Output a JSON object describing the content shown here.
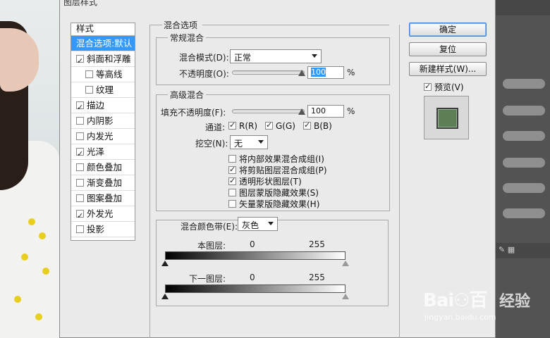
{
  "dialog": {
    "title": "图层样式"
  },
  "styles_list": {
    "header": "样式",
    "items": [
      {
        "label": "混合选项:默认",
        "checkbox": false,
        "selected": true,
        "indent": false
      },
      {
        "label": "斜面和浮雕",
        "checkbox": true,
        "checked": true,
        "indent": false
      },
      {
        "label": "等高线",
        "checkbox": true,
        "checked": false,
        "indent": true
      },
      {
        "label": "纹理",
        "checkbox": true,
        "checked": false,
        "indent": true
      },
      {
        "label": "描边",
        "checkbox": true,
        "checked": true,
        "indent": false
      },
      {
        "label": "内阴影",
        "checkbox": true,
        "checked": false,
        "indent": false
      },
      {
        "label": "内发光",
        "checkbox": true,
        "checked": false,
        "indent": false
      },
      {
        "label": "光泽",
        "checkbox": true,
        "checked": true,
        "indent": false
      },
      {
        "label": "颜色叠加",
        "checkbox": true,
        "checked": false,
        "indent": false
      },
      {
        "label": "渐变叠加",
        "checkbox": true,
        "checked": false,
        "indent": false
      },
      {
        "label": "图案叠加",
        "checkbox": true,
        "checked": false,
        "indent": false
      },
      {
        "label": "外发光",
        "checkbox": true,
        "checked": true,
        "indent": false
      },
      {
        "label": "投影",
        "checkbox": true,
        "checked": false,
        "indent": false
      }
    ]
  },
  "blend_options": {
    "section_title": "混合选项",
    "general": {
      "title": "常规混合",
      "mode_label": "混合模式(D):",
      "mode_value": "正常",
      "opacity_label": "不透明度(O):",
      "opacity_value": "100",
      "percent": "%"
    },
    "advanced": {
      "title": "高级混合",
      "fill_label": "填充不透明度(F):",
      "fill_value": "100",
      "percent": "%",
      "channels_label": "通道:",
      "channel_r": "R(R)",
      "channel_g": "G(G)",
      "channel_b": "B(B)",
      "knockout_label": "挖空(N):",
      "knockout_value": "无",
      "options": [
        {
          "label": "将内部效果混合成组(I)",
          "checked": false
        },
        {
          "label": "将剪贴图层混合成组(P)",
          "checked": true
        },
        {
          "label": "透明形状图层(T)",
          "checked": true
        },
        {
          "label": "图层蒙版隐藏效果(S)",
          "checked": false
        },
        {
          "label": "矢量蒙版隐藏效果(H)",
          "checked": false
        }
      ]
    },
    "blend_if": {
      "label": "混合颜色带(E):",
      "value": "灰色",
      "this_layer_label": "本图层:",
      "this_layer_min": "0",
      "this_layer_max": "255",
      "underlying_label": "下一图层:",
      "underlying_min": "0",
      "underlying_max": "255"
    }
  },
  "buttons": {
    "ok": "确定",
    "reset": "复位",
    "new_style": "新建样式(W)...",
    "preview_label": "预览(V)",
    "preview_checked": true
  },
  "preview": {
    "swatch_color": "#5d7f55"
  },
  "watermark": {
    "logo": "Bai⚇百",
    "cn": "经验",
    "url": "jingyan.baidu.com"
  }
}
